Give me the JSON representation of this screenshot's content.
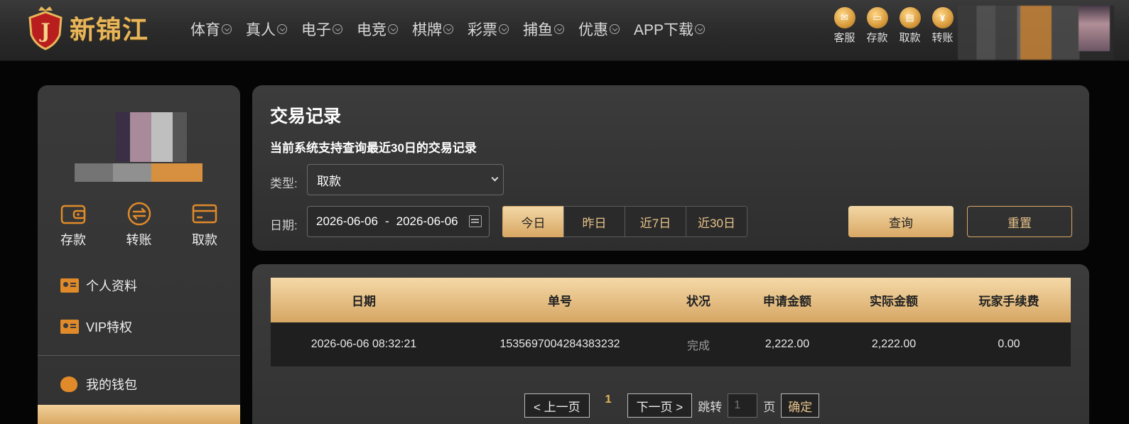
{
  "brand": {
    "name": "新锦江",
    "logo_letter": "J",
    "accent": "#e8b65a"
  },
  "nav": [
    "体育",
    "真人",
    "电子",
    "电竞",
    "棋牌",
    "彩票",
    "捕鱼",
    "优惠",
    "APP下载"
  ],
  "quick": [
    {
      "label": "客服",
      "icon": "chat-icon"
    },
    {
      "label": "存款",
      "icon": "wallet-icon"
    },
    {
      "label": "取款",
      "icon": "atm-icon"
    },
    {
      "label": "转账",
      "icon": "transfer-icon"
    }
  ],
  "sidebar": {
    "actions": [
      {
        "label": "存款",
        "icon": "wallet-icon"
      },
      {
        "label": "转账",
        "icon": "transfer-icon"
      },
      {
        "label": "取款",
        "icon": "card-icon"
      }
    ],
    "menu": [
      "个人资料",
      "VIP特权",
      "我的钱包"
    ]
  },
  "filter": {
    "title": "交易记录",
    "note": "当前系统支持查询最近30日的交易记录",
    "type_label": "类型:",
    "type_value": "取款",
    "date_label": "日期:",
    "date_start": "2026-06-06",
    "date_sep": "-",
    "date_end": "2026-06-06",
    "ranges": [
      "今日",
      "昨日",
      "近7日",
      "近30日"
    ],
    "query": "查询",
    "reset": "重置"
  },
  "table": {
    "headers": [
      "日期",
      "单号",
      "状况",
      "申请金额",
      "实际金额",
      "玩家手续费"
    ],
    "rows": [
      [
        "2026-06-06 08:32:21",
        "1535697004284383232",
        "完成",
        "2,222.00",
        "2,222.00",
        "0.00"
      ]
    ]
  },
  "pager": {
    "prev": "< 上一页",
    "current": "1",
    "next": "下一页 >",
    "jump": "跳转",
    "input_placeholder": "1",
    "page_unit": "页",
    "confirm": "确定"
  }
}
